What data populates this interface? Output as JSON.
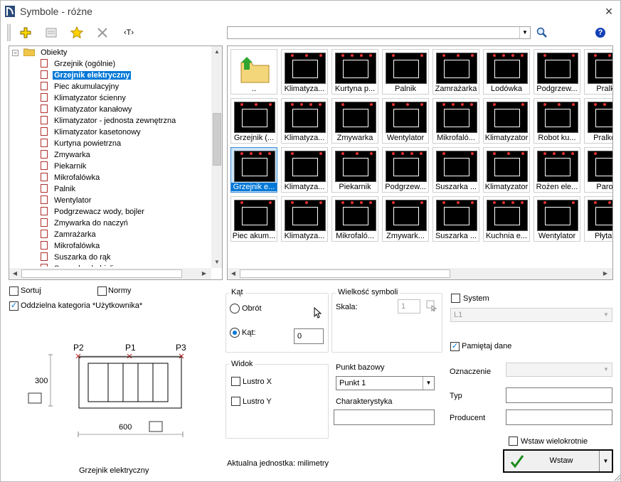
{
  "window": {
    "title": "Symbole - różne",
    "close": "×"
  },
  "toolbar": {
    "new_icon": "plus-icon",
    "props_icon": "properties-icon",
    "fav_icon": "star-icon",
    "delete_icon": "delete-icon",
    "text_label": "‹T›",
    "search_icon": "magnifier-icon",
    "help_label": "?"
  },
  "tree": {
    "root": "Obiekty",
    "items": [
      "Grzejnik (ogólnie)",
      "Grzejnik elektryczny",
      "Piec akumulacyjny",
      "Klimatyzator ścienny",
      "Klimatyzator kanałowy",
      "Klimatyzator - jednosta zewnętrzna",
      "Klimatyzator kasetonowy",
      "Kurtyna powietrzna",
      "Zmywarka",
      "Piekarnik",
      "Mikrofalówka",
      "Palnik",
      "Wentylator",
      "Podgrzewacz wody, bojler",
      "Zmywarka do naczyń",
      "Zamrażarka",
      "Mikrofalówka",
      "Suszarka do rąk",
      "Suszarka do bielizny"
    ],
    "selected_index": 1
  },
  "grid": {
    "rows": [
      [
        "..",
        "Klimatyza...",
        "Kurtyna p...",
        "Palnik",
        "Zamrażarka",
        "Lodówka",
        "Podgrzew...",
        "Pralko"
      ],
      [
        "Grzejnik (...",
        "Klimatyza...",
        "Zmywarka",
        "Wentylator",
        "Mikrofaló...",
        "Klimatyzator",
        "Robot ku...",
        "Pralko s"
      ],
      [
        "Grzejnik e...",
        "Klimatyza...",
        "Piekarnik",
        "Podgrzew...",
        "Suszarka ...",
        "Klimatyzator",
        "Rożen ele...",
        "Parow"
      ],
      [
        "Piec akum...",
        "Klimatyza...",
        "Mikrofaló...",
        "Zmywark...",
        "Suszarka ...",
        "Kuchnia e...",
        "Wentylator",
        "Płyta el"
      ]
    ],
    "selected": "Grzejnik e..."
  },
  "options": {
    "sortuj": "Sortuj",
    "normy": "Normy",
    "oddzielna": "Oddzielna kategoria *Użytkownika*"
  },
  "preview": {
    "p1": "P1",
    "p2": "P2",
    "p3": "P3",
    "height": "300",
    "width": "600",
    "caption": "Grzejnik elektryczny"
  },
  "kat": {
    "title": "Kąt",
    "obrot": "Obrót",
    "kat": "Kąt:",
    "value": "0"
  },
  "wielkosc": {
    "title": "Wielkość symboli",
    "skala": "Skala:",
    "value": "1"
  },
  "widok": {
    "title": "Widok",
    "lustro_x": "Lustro X",
    "lustro_y": "Lustro Y"
  },
  "punkt": {
    "label": "Punkt bazowy",
    "value": "Punkt 1",
    "charakterystyka": "Charakterystyka"
  },
  "unit": "Aktualna jednostka: milimetry",
  "right": {
    "system": "System",
    "layer": "L1",
    "pamietaj": "Pamiętaj dane",
    "oznaczenie": "Oznaczenie",
    "typ": "Typ",
    "producent": "Producent",
    "wielokrotnie": "Wstaw wielokrotnie",
    "wstaw": "Wstaw"
  }
}
